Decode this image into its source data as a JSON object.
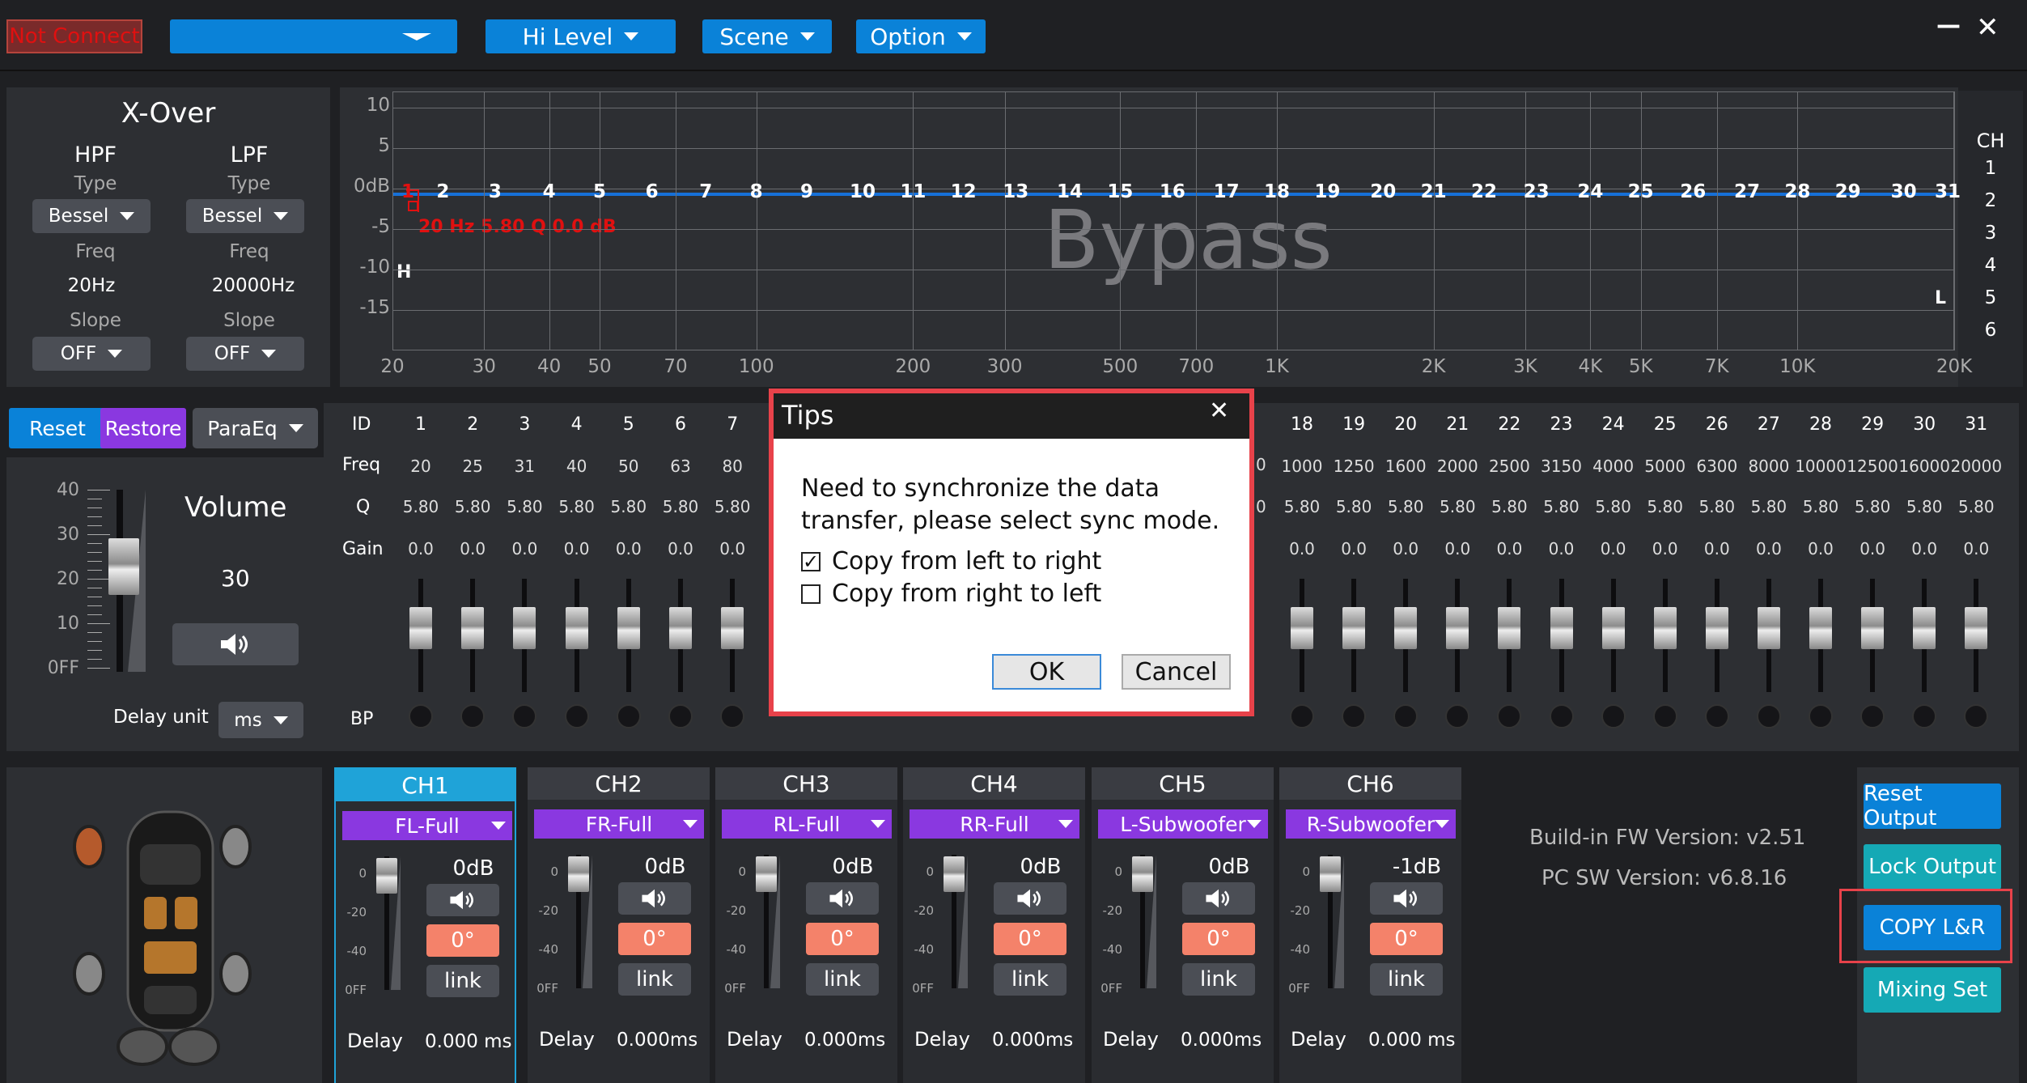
{
  "topbar": {
    "status": "Not Connect",
    "device_select": "",
    "hi_level": "Hi Level",
    "scene": "Scene",
    "option": "Option",
    "minimize": "—",
    "close": "✕"
  },
  "xover": {
    "title": "X-Over",
    "hpf": "HPF",
    "lpf": "LPF",
    "type_label": "Type",
    "hpf_type": "Bessel",
    "lpf_type": "Bessel",
    "freq_label": "Freq",
    "hpf_freq": "20Hz",
    "lpf_freq": "20000Hz",
    "slope_label": "Slope",
    "hpf_slope": "OFF",
    "lpf_slope": "OFF"
  },
  "graph": {
    "y_ticks": [
      "10",
      "5",
      "0dB",
      "-5",
      "-10",
      "-15"
    ],
    "x_ticks": [
      "20",
      "30",
      "40",
      "50",
      "70",
      "100",
      "200",
      "300",
      "500",
      "700",
      "1K",
      "2K",
      "3K",
      "4K",
      "5K",
      "7K",
      "10K",
      "20K"
    ],
    "band_labels": [
      "1",
      "2",
      "3",
      "4",
      "5",
      "6",
      "7",
      "8",
      "9",
      "10",
      "11",
      "12",
      "13",
      "14",
      "15",
      "16",
      "17",
      "18",
      "19",
      "20",
      "21",
      "22",
      "23",
      "24",
      "25",
      "26",
      "27",
      "28",
      "29",
      "30",
      "31"
    ],
    "marker": "20 Hz 5.80 Q 0.0 dB",
    "watermark": "Bypass",
    "h_label": "H",
    "l_label": "L",
    "ch_title": "CH",
    "channels": [
      "1",
      "2",
      "3",
      "4",
      "5",
      "6"
    ]
  },
  "eq": {
    "reset": "Reset",
    "restore": "Restore",
    "mode": "ParaEq",
    "row_labels": {
      "id": "ID",
      "freq": "Freq",
      "q": "Q",
      "gain": "Gain",
      "bp": "BP"
    },
    "left_bands": [
      {
        "id": "1",
        "freq": "20",
        "q": "5.80",
        "gain": "0.0"
      },
      {
        "id": "2",
        "freq": "25",
        "q": "5.80",
        "gain": "0.0"
      },
      {
        "id": "3",
        "freq": "31",
        "q": "5.80",
        "gain": "0.0"
      },
      {
        "id": "4",
        "freq": "40",
        "q": "5.80",
        "gain": "0.0"
      },
      {
        "id": "5",
        "freq": "50",
        "q": "5.80",
        "gain": "0.0"
      },
      {
        "id": "6",
        "freq": "63",
        "q": "5.80",
        "gain": "0.0"
      },
      {
        "id": "7",
        "freq": "80",
        "q": "5.80",
        "gain": "0.0"
      }
    ],
    "right_bands": [
      {
        "id": "18",
        "freq": "1000",
        "q": "5.80",
        "gain": "0.0"
      },
      {
        "id": "19",
        "freq": "1250",
        "q": "5.80",
        "gain": "0.0"
      },
      {
        "id": "20",
        "freq": "1600",
        "q": "5.80",
        "gain": "0.0"
      },
      {
        "id": "21",
        "freq": "2000",
        "q": "5.80",
        "gain": "0.0"
      },
      {
        "id": "22",
        "freq": "2500",
        "q": "5.80",
        "gain": "0.0"
      },
      {
        "id": "23",
        "freq": "3150",
        "q": "5.80",
        "gain": "0.0"
      },
      {
        "id": "24",
        "freq": "4000",
        "q": "5.80",
        "gain": "0.0"
      },
      {
        "id": "25",
        "freq": "5000",
        "q": "5.80",
        "gain": "0.0"
      },
      {
        "id": "26",
        "freq": "6300",
        "q": "5.80",
        "gain": "0.0"
      },
      {
        "id": "27",
        "freq": "8000",
        "q": "5.80",
        "gain": "0.0"
      },
      {
        "id": "28",
        "freq": "10000",
        "q": "5.80",
        "gain": "0.0"
      },
      {
        "id": "29",
        "freq": "12500",
        "q": "5.80",
        "gain": "0.0"
      },
      {
        "id": "30",
        "freq": "16000",
        "q": "5.80",
        "gain": "0.0"
      },
      {
        "id": "31",
        "freq": "20000",
        "q": "5.80",
        "gain": "0.0"
      }
    ],
    "partial_col": "0"
  },
  "volume": {
    "title": "Volume",
    "value": "30",
    "scale": [
      "40",
      "30",
      "20",
      "10",
      "0FF"
    ],
    "delay_unit_label": "Delay unit",
    "delay_unit": "ms",
    "level": 0.75
  },
  "channels": [
    {
      "name": "CH1",
      "type": "FL-Full",
      "gain": "0dB",
      "phase": "0°",
      "link": "link",
      "delay_label": "Delay",
      "delay": "0.000 ms",
      "active": true
    },
    {
      "name": "CH2",
      "type": "FR-Full",
      "gain": "0dB",
      "phase": "0°",
      "link": "link",
      "delay_label": "Delay",
      "delay": "0.000ms",
      "active": false
    },
    {
      "name": "CH3",
      "type": "RL-Full",
      "gain": "0dB",
      "phase": "0°",
      "link": "link",
      "delay_label": "Delay",
      "delay": "0.000ms",
      "active": false
    },
    {
      "name": "CH4",
      "type": "RR-Full",
      "gain": "0dB",
      "phase": "0°",
      "link": "link",
      "delay_label": "Delay",
      "delay": "0.000ms",
      "active": false
    },
    {
      "name": "CH5",
      "type": "L-Subwoofer",
      "gain": "0dB",
      "phase": "0°",
      "link": "link",
      "delay_label": "Delay",
      "delay": "0.000ms",
      "active": false
    },
    {
      "name": "CH6",
      "type": "R-Subwoofer",
      "gain": "-1dB",
      "phase": "0°",
      "link": "link",
      "delay_label": "Delay",
      "delay": "0.000 ms",
      "active": false
    }
  ],
  "channel_scale": [
    "0",
    "-20",
    "-40",
    "0FF"
  ],
  "version": {
    "fw": "Build-in FW Version: v2.51",
    "pc": "PC SW Version: v6.8.16"
  },
  "side_buttons": {
    "reset_output": "Reset Output",
    "lock_output": "Lock Output",
    "copy_lr": "COPY L&R",
    "mixing_set": "Mixing Set"
  },
  "dialog": {
    "title": "Tips",
    "close": "✕",
    "message": "Need to synchronize the data transfer, please select sync mode.",
    "option1": "Copy from left to right",
    "option1_checked": true,
    "option2": "Copy from right to left",
    "option2_checked": false,
    "ok": "OK",
    "cancel": "Cancel"
  },
  "colors": {
    "accent_blue": "#0a82d8",
    "purple": "#8a38e0",
    "teal": "#15a9b5",
    "phase_orange": "#f4826a",
    "marker_red": "#e01010",
    "highlight_red": "#e8424a"
  }
}
